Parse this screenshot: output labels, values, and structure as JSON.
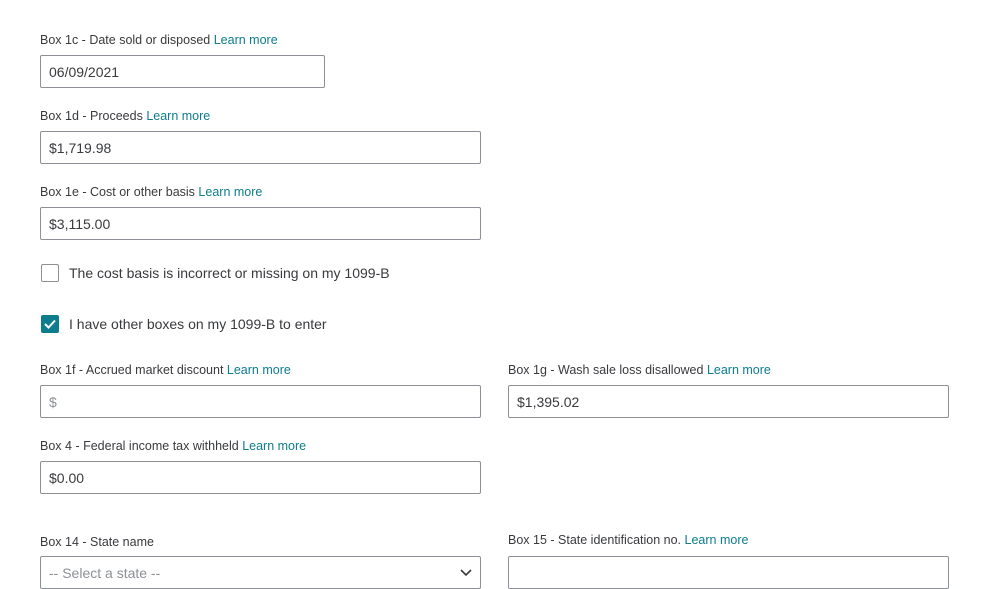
{
  "learn_more": "Learn more",
  "box1c": {
    "label": "Box 1c - Date sold or disposed",
    "value": "06/09/2021"
  },
  "box1d": {
    "label": "Box 1d - Proceeds",
    "value": "$1,719.98"
  },
  "box1e": {
    "label": "Box 1e - Cost or other basis",
    "value": "$3,115.00"
  },
  "basis_checkbox": {
    "label": "The cost basis is incorrect or missing on my 1099-B",
    "checked": false
  },
  "other_boxes_checkbox": {
    "label": "I have other boxes on my 1099-B to enter",
    "checked": true
  },
  "box1f": {
    "label": "Box 1f - Accrued market discount",
    "value": "",
    "placeholder": "$"
  },
  "box1g": {
    "label": "Box 1g - Wash sale loss disallowed",
    "value": "$1,395.02"
  },
  "box4": {
    "label": "Box 4 - Federal income tax withheld",
    "value": "$0.00"
  },
  "box14": {
    "label": "Box 14 - State name",
    "selected": "-- Select a state --"
  },
  "box15": {
    "label": "Box 15 - State identification no.",
    "value": ""
  },
  "colors": {
    "accent": "#0d7c8c",
    "text": "#393a3d",
    "border": "#8d9096"
  }
}
